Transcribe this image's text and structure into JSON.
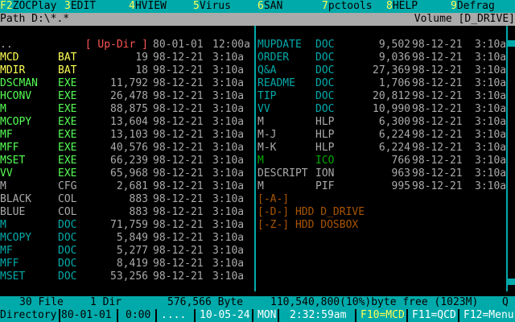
{
  "fnkeys": [
    {
      "key": "F2",
      "label": "ZOCPlay"
    },
    {
      "key": "3",
      "label": "EDIT"
    },
    {
      "key": "4",
      "label": "HVIEW"
    },
    {
      "key": "5",
      "label": "Virus"
    },
    {
      "key": "6",
      "label": "SAN"
    },
    {
      "key": "7",
      "label": "pctools"
    },
    {
      "key": "8",
      "label": "HELP"
    },
    {
      "key": "9",
      "label": "Defrag"
    }
  ],
  "path": "Path D:\\*.*",
  "volume": "Volume [D_DRIVE]",
  "left_files": [
    {
      "name": "..",
      "ext": "",
      "size": "[ Up-Dir ]",
      "date": "80-01-01",
      "time": "12:00a",
      "color": "#aaaaaa",
      "extcolor": "#aaaaaa",
      "sizecolor": "#ff5555"
    },
    {
      "name": "MCD",
      "ext": "BAT",
      "size": "19",
      "date": "98-12-21",
      "time": "3:10a",
      "color": "#ffff55",
      "extcolor": "#ffff55"
    },
    {
      "name": "MDIR",
      "ext": "BAT",
      "size": "18",
      "date": "98-12-21",
      "time": "3:10a",
      "color": "#ffff55",
      "extcolor": "#ffff55"
    },
    {
      "name": "DSCMAN",
      "ext": "EXE",
      "size": "11,792",
      "date": "98-12-21",
      "time": "3:10a",
      "color": "#55ff55",
      "extcolor": "#55ff55"
    },
    {
      "name": "HCONV",
      "ext": "EXE",
      "size": "26,478",
      "date": "98-12-21",
      "time": "3:10a",
      "color": "#55ff55",
      "extcolor": "#55ff55"
    },
    {
      "name": "M",
      "ext": "EXE",
      "size": "88,875",
      "date": "98-12-21",
      "time": "3:10a",
      "color": "#55ff55",
      "extcolor": "#55ff55"
    },
    {
      "name": "MCOPY",
      "ext": "EXE",
      "size": "13,604",
      "date": "98-12-21",
      "time": "3:10a",
      "color": "#55ff55",
      "extcolor": "#55ff55"
    },
    {
      "name": "MF",
      "ext": "EXE",
      "size": "13,103",
      "date": "98-12-21",
      "time": "3:10a",
      "color": "#55ff55",
      "extcolor": "#55ff55"
    },
    {
      "name": "MFF",
      "ext": "EXE",
      "size": "40,576",
      "date": "98-12-21",
      "time": "3:10a",
      "color": "#55ff55",
      "extcolor": "#55ff55"
    },
    {
      "name": "MSET",
      "ext": "EXE",
      "size": "66,239",
      "date": "98-12-21",
      "time": "3:10a",
      "color": "#55ff55",
      "extcolor": "#55ff55"
    },
    {
      "name": "VV",
      "ext": "EXE",
      "size": "65,968",
      "date": "98-12-21",
      "time": "3:10a",
      "color": "#55ff55",
      "extcolor": "#55ff55"
    },
    {
      "name": "M",
      "ext": "CFG",
      "size": "2,681",
      "date": "98-12-21",
      "time": "3:10a",
      "color": "#aaaaaa",
      "extcolor": "#aaaaaa"
    },
    {
      "name": "BLACK",
      "ext": "COL",
      "size": "883",
      "date": "98-12-21",
      "time": "3:10a",
      "color": "#aaaaaa",
      "extcolor": "#aaaaaa"
    },
    {
      "name": "BLUE",
      "ext": "COL",
      "size": "883",
      "date": "98-12-21",
      "time": "3:10a",
      "color": "#aaaaaa",
      "extcolor": "#aaaaaa"
    },
    {
      "name": "M",
      "ext": "DOC",
      "size": "71,759",
      "date": "98-12-21",
      "time": "3:10a",
      "color": "#00aaaa",
      "extcolor": "#00aaaa"
    },
    {
      "name": "MCOPY",
      "ext": "DOC",
      "size": "5,849",
      "date": "98-12-21",
      "time": "3:10a",
      "color": "#00aaaa",
      "extcolor": "#00aaaa"
    },
    {
      "name": "MF",
      "ext": "DOC",
      "size": "5,277",
      "date": "98-12-21",
      "time": "3:10a",
      "color": "#00aaaa",
      "extcolor": "#00aaaa"
    },
    {
      "name": "MFF",
      "ext": "DOC",
      "size": "8,419",
      "date": "98-12-21",
      "time": "3:10a",
      "color": "#00aaaa",
      "extcolor": "#00aaaa"
    },
    {
      "name": "MSET",
      "ext": "DOC",
      "size": "53,256",
      "date": "98-12-21",
      "time": "3:10a",
      "color": "#00aaaa",
      "extcolor": "#00aaaa"
    }
  ],
  "right_files": [
    {
      "name": "MUPDATE",
      "ext": "DOC",
      "size": "9,502",
      "date": "98-12-21",
      "time": "3:10a",
      "color": "#00aaaa",
      "extcolor": "#00aaaa"
    },
    {
      "name": "ORDER",
      "ext": "DOC",
      "size": "9,036",
      "date": "98-12-21",
      "time": "3:10a",
      "color": "#00aaaa",
      "extcolor": "#00aaaa"
    },
    {
      "name": "Q&A",
      "ext": "DOC",
      "size": "27,369",
      "date": "98-12-21",
      "time": "3:10a",
      "color": "#00aaaa",
      "extcolor": "#00aaaa"
    },
    {
      "name": "README",
      "ext": "DOC",
      "size": "1,706",
      "date": "98-12-21",
      "time": "3:10a",
      "color": "#00aaaa",
      "extcolor": "#00aaaa"
    },
    {
      "name": "TIP",
      "ext": "DOC",
      "size": "20,812",
      "date": "98-12-21",
      "time": "3:10a",
      "color": "#00aaaa",
      "extcolor": "#00aaaa"
    },
    {
      "name": "VV",
      "ext": "DOC",
      "size": "10,990",
      "date": "98-12-21",
      "time": "3:10a",
      "color": "#00aaaa",
      "extcolor": "#00aaaa"
    },
    {
      "name": "M",
      "ext": "HLP",
      "size": "6,300",
      "date": "98-12-21",
      "time": "3:10a",
      "color": "#aaaaaa",
      "extcolor": "#aaaaaa"
    },
    {
      "name": "M-J",
      "ext": "HLP",
      "size": "6,224",
      "date": "98-12-21",
      "time": "3:10a",
      "color": "#aaaaaa",
      "extcolor": "#aaaaaa"
    },
    {
      "name": "M-K",
      "ext": "HLP",
      "size": "6,224",
      "date": "98-12-21",
      "time": "3:10a",
      "color": "#aaaaaa",
      "extcolor": "#aaaaaa"
    },
    {
      "name": "M",
      "ext": "ICO",
      "size": "766",
      "date": "98-12-21",
      "time": "3:10a",
      "color": "#00aa00",
      "extcolor": "#00aa00"
    },
    {
      "name": "DESCRIPT",
      "ext": "ION",
      "size": "963",
      "date": "98-12-21",
      "time": "3:10a",
      "color": "#aaaaaa",
      "extcolor": "#aaaaaa"
    },
    {
      "name": "M",
      "ext": "PIF",
      "size": "995",
      "date": "98-12-21",
      "time": "3:10a",
      "color": "#aaaaaa",
      "extcolor": "#aaaaaa"
    }
  ],
  "drives": [
    "[-A-]",
    "[-D-] HDD D_DRIVE",
    "[-Z-] HDD DOSBOX"
  ],
  "status": {
    "files": "30 File",
    "dirs": "1 Dir",
    "bytes": "576,566 Byte",
    "free": "110,540,800(10%)byte free (1023M)",
    "q": "Q"
  },
  "bottom": {
    "dir": "Directory",
    "date": "80-01-01",
    "time": "0:00",
    "dots": "....",
    "today": "10-05-24",
    "day": "MON",
    "clock": "2:32:59am",
    "f10": "F10=MCD",
    "f11": "F11=QCD",
    "f12": "F12=Menu"
  }
}
